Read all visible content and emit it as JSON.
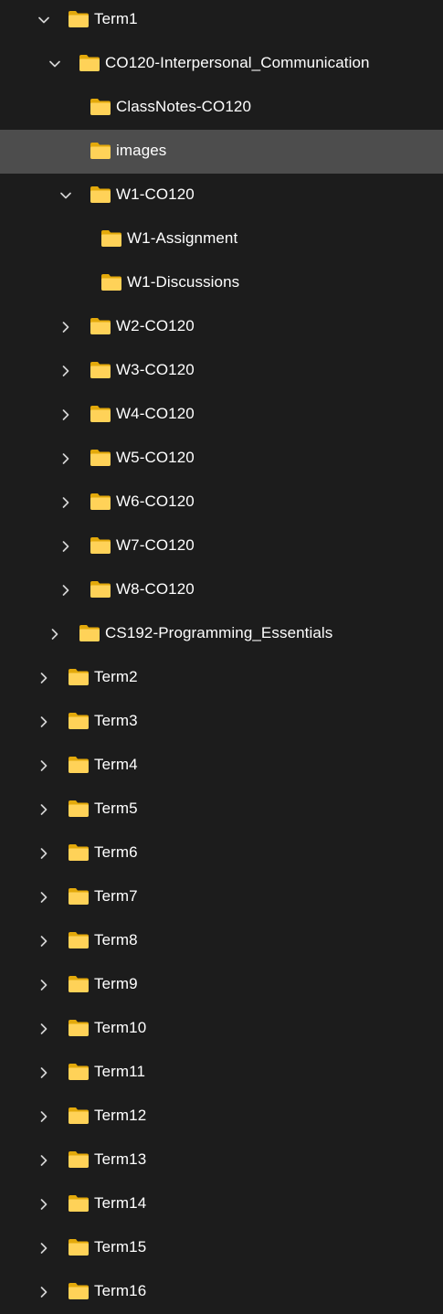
{
  "tree": {
    "items": [
      {
        "label": "Term1",
        "level": 0,
        "expandable": true,
        "expanded": true,
        "selected": false
      },
      {
        "label": "CO120-Interpersonal_Communication",
        "level": 1,
        "expandable": true,
        "expanded": true,
        "selected": false
      },
      {
        "label": "ClassNotes-CO120",
        "level": 2,
        "expandable": false,
        "expanded": false,
        "selected": false
      },
      {
        "label": "images",
        "level": 2,
        "expandable": false,
        "expanded": false,
        "selected": true
      },
      {
        "label": "W1-CO120",
        "level": 2,
        "expandable": true,
        "expanded": true,
        "selected": false
      },
      {
        "label": "W1-Assignment",
        "level": 3,
        "expandable": false,
        "expanded": false,
        "selected": false
      },
      {
        "label": "W1-Discussions",
        "level": 3,
        "expandable": false,
        "expanded": false,
        "selected": false
      },
      {
        "label": "W2-CO120",
        "level": 2,
        "expandable": true,
        "expanded": false,
        "selected": false
      },
      {
        "label": "W3-CO120",
        "level": 2,
        "expandable": true,
        "expanded": false,
        "selected": false
      },
      {
        "label": "W4-CO120",
        "level": 2,
        "expandable": true,
        "expanded": false,
        "selected": false
      },
      {
        "label": "W5-CO120",
        "level": 2,
        "expandable": true,
        "expanded": false,
        "selected": false
      },
      {
        "label": "W6-CO120",
        "level": 2,
        "expandable": true,
        "expanded": false,
        "selected": false
      },
      {
        "label": "W7-CO120",
        "level": 2,
        "expandable": true,
        "expanded": false,
        "selected": false
      },
      {
        "label": "W8-CO120",
        "level": 2,
        "expandable": true,
        "expanded": false,
        "selected": false
      },
      {
        "label": "CS192-Programming_Essentials",
        "level": 1,
        "expandable": true,
        "expanded": false,
        "selected": false
      },
      {
        "label": "Term2",
        "level": 0,
        "expandable": true,
        "expanded": false,
        "selected": false
      },
      {
        "label": "Term3",
        "level": 0,
        "expandable": true,
        "expanded": false,
        "selected": false
      },
      {
        "label": "Term4",
        "level": 0,
        "expandable": true,
        "expanded": false,
        "selected": false
      },
      {
        "label": "Term5",
        "level": 0,
        "expandable": true,
        "expanded": false,
        "selected": false
      },
      {
        "label": "Term6",
        "level": 0,
        "expandable": true,
        "expanded": false,
        "selected": false
      },
      {
        "label": "Term7",
        "level": 0,
        "expandable": true,
        "expanded": false,
        "selected": false
      },
      {
        "label": "Term8",
        "level": 0,
        "expandable": true,
        "expanded": false,
        "selected": false
      },
      {
        "label": "Term9",
        "level": 0,
        "expandable": true,
        "expanded": false,
        "selected": false
      },
      {
        "label": "Term10",
        "level": 0,
        "expandable": true,
        "expanded": false,
        "selected": false
      },
      {
        "label": "Term11",
        "level": 0,
        "expandable": true,
        "expanded": false,
        "selected": false
      },
      {
        "label": "Term12",
        "level": 0,
        "expandable": true,
        "expanded": false,
        "selected": false
      },
      {
        "label": "Term13",
        "level": 0,
        "expandable": true,
        "expanded": false,
        "selected": false
      },
      {
        "label": "Term14",
        "level": 0,
        "expandable": true,
        "expanded": false,
        "selected": false
      },
      {
        "label": "Term15",
        "level": 0,
        "expandable": true,
        "expanded": false,
        "selected": false
      },
      {
        "label": "Term16",
        "level": 0,
        "expandable": true,
        "expanded": false,
        "selected": false
      }
    ]
  },
  "icons": {
    "folder": "folder-icon",
    "expanded": "chevron-down-icon",
    "collapsed": "chevron-right-icon"
  },
  "colors": {
    "background": "#1c1c1c",
    "selected_row": "#4d4d4d",
    "text": "#ffffff",
    "chevron": "#d4d4d4",
    "folder_back": "#e3a90b",
    "folder_front": "#ffd258"
  }
}
